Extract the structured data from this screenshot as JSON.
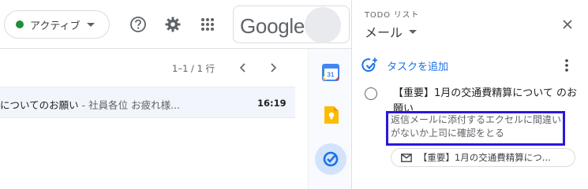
{
  "topbar": {
    "status_label": "アクティブ",
    "status_color": "#1e8e3e",
    "icons": [
      "help-icon",
      "gear-icon",
      "apps-grid-icon"
    ],
    "google_logo_text": "Google"
  },
  "pager": {
    "range_text": "1–1 / 1 行"
  },
  "email_list": {
    "rows": [
      {
        "subject": "についてのお願い",
        "snippet": " - 社員各位 お疲れ様...",
        "time": "16:19"
      }
    ]
  },
  "rail": {
    "icons": [
      "calendar-icon",
      "keep-icon",
      "tasks-icon"
    ],
    "calendar_day": "31"
  },
  "tasks_panel": {
    "app_label": "TODO リスト",
    "list_name": "メール",
    "add_task_label": "タスクを追加",
    "task": {
      "title": "【重要】1月の交通費精算について のお願い",
      "notes": "返信メールに添付するエクセルに間違いがないか上司に確認をとる",
      "linked_email": "【重要】1月の交通費精算につ..."
    },
    "highlight_color": "#2b17d9",
    "accent_color": "#1a73e8"
  }
}
